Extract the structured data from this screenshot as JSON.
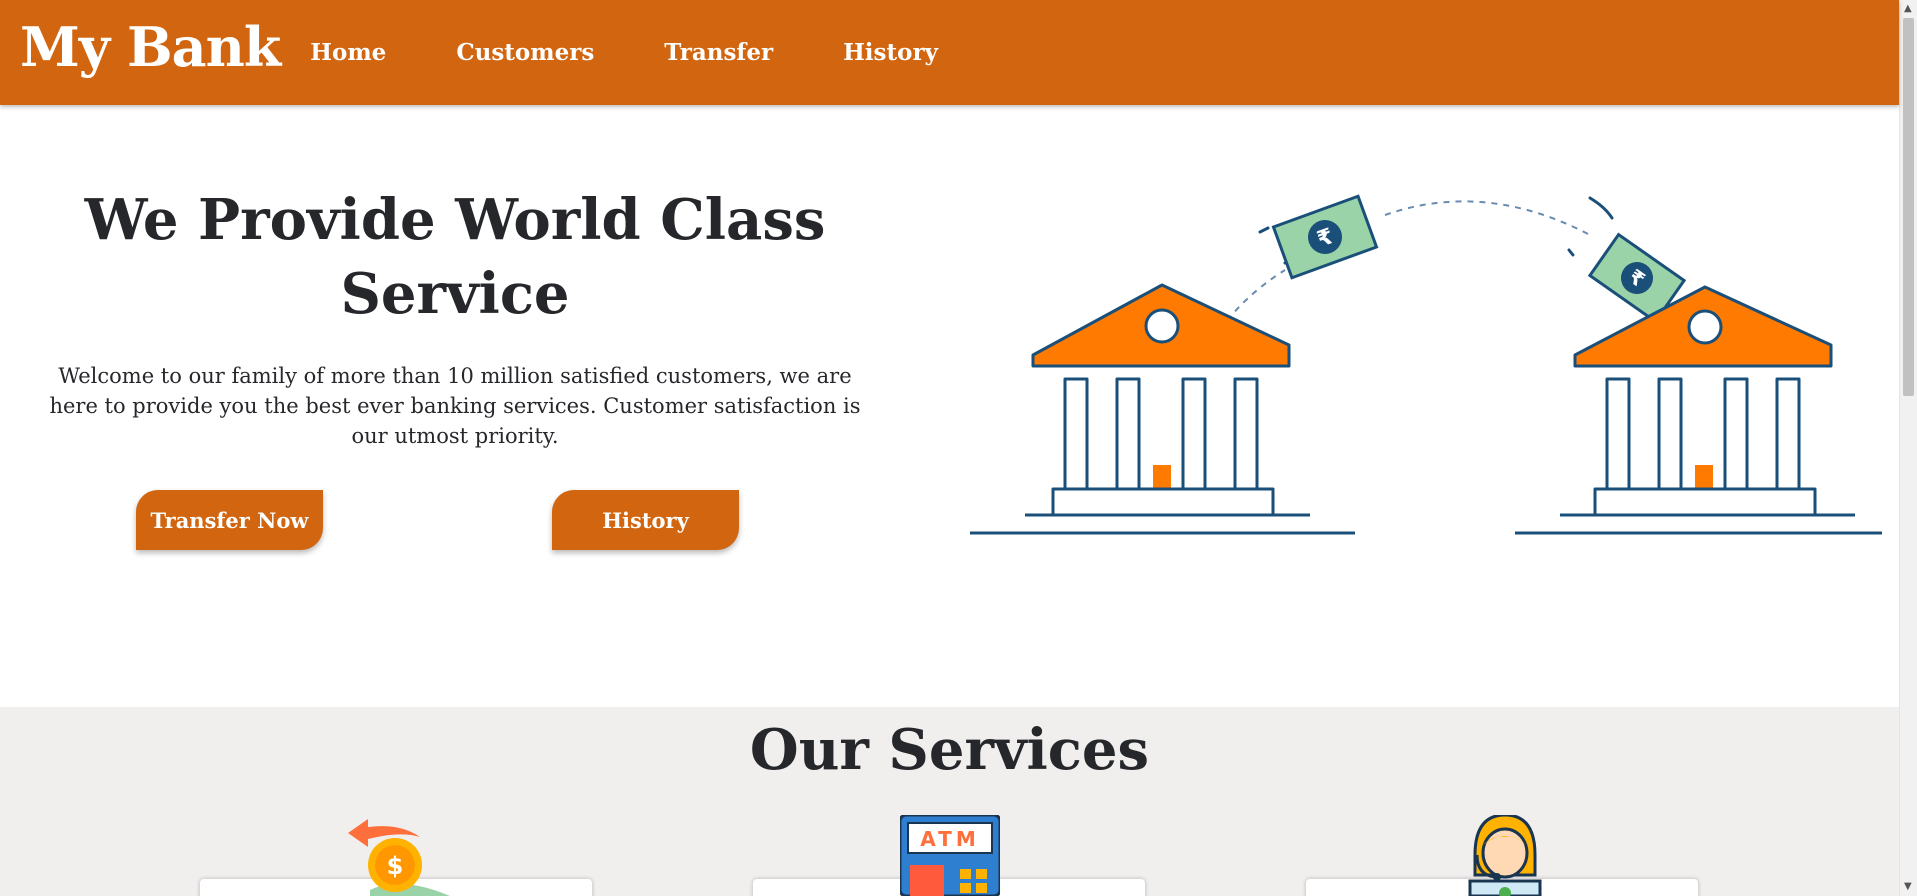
{
  "navbar": {
    "brand": "My Bank",
    "links": [
      "Home",
      "Customers",
      "Transfer",
      "History"
    ]
  },
  "hero": {
    "title": "We Provide World Class Service",
    "description": "Welcome to our family of more than 10 million satisfied customers, we are here to provide you the best ever banking services. Customer satisfaction is our utmost priority.",
    "transfer_button": "Transfer Now",
    "history_button": "History",
    "illustration": {
      "currency_symbol": "₹"
    }
  },
  "services": {
    "title": "Our Services",
    "atm_label": "ATM",
    "cards": [
      {
        "icon": "money-transfer-icon"
      },
      {
        "icon": "atm-icon"
      },
      {
        "icon": "customer-support-icon"
      }
    ]
  },
  "colors": {
    "primary": "#d2650f",
    "bank_roof": "#ff7a00",
    "bank_outline": "#1a4f7a",
    "banknote": "#9bd3a8",
    "services_bg": "#f1eeee"
  }
}
